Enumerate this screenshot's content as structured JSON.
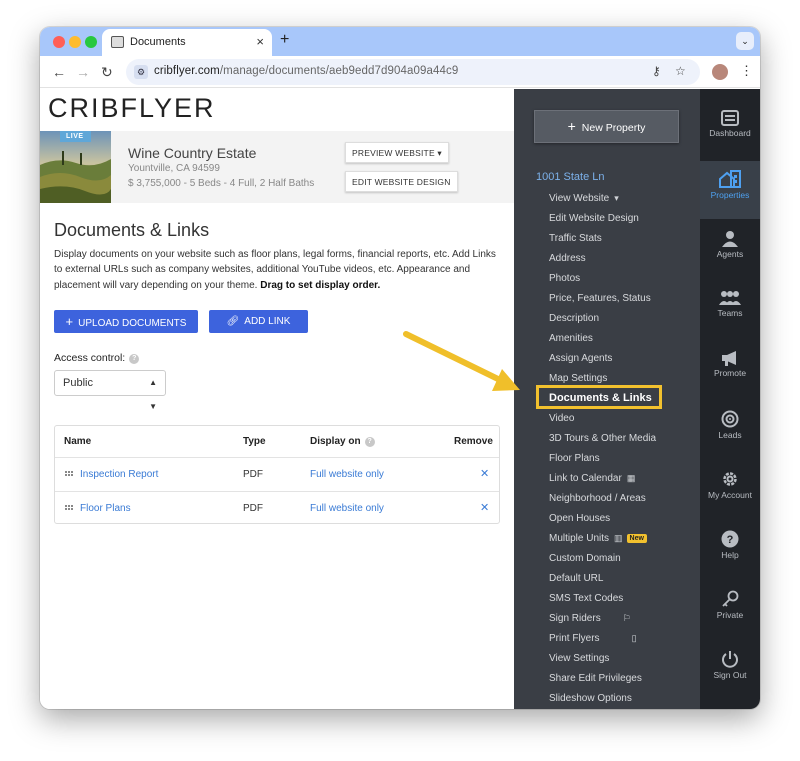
{
  "browser": {
    "tab_title": "Documents",
    "tab_close": "×",
    "new_tab": "+",
    "url_domain": "cribflyer.com",
    "url_path": "/manage/documents/aeb9edd7d904a09a44c9"
  },
  "page": {
    "logo": "CRIBFLYER",
    "property": {
      "live_badge": "LIVE",
      "name": "Wine Country Estate",
      "city": "Yountville, CA 94599",
      "summary": "$ 3,755,000 - 5 Beds - 4 Full, 2 Half Baths",
      "preview_button": "PREVIEW WEBSITE ▾",
      "edit_design_button": "EDIT WEBSITE DESIGN"
    },
    "heading": "Documents & Links",
    "description": "Display documents on your website such as floor plans, legal forms, financial reports, etc. Add Links to external URLs such as company websites, additional YouTube videos, etc. Appearance and placement will vary depending on your theme.",
    "description_bold": "Drag to set display order.",
    "upload_button": "UPLOAD DOCUMENTS",
    "add_link_button": "ADD LINK",
    "access_label": "Access control:",
    "access_value": "Public",
    "table": {
      "headers": [
        "Name",
        "Type",
        "Display on",
        "Remove"
      ],
      "rows": [
        {
          "name": "Inspection Report",
          "type": "PDF",
          "display": "Full website only"
        },
        {
          "name": "Floor Plans",
          "type": "PDF",
          "display": "Full website only"
        }
      ]
    }
  },
  "sidebar": {
    "new_property": "New Property",
    "address": "1001 State Ln",
    "items": [
      "View Website",
      "Edit Website Design",
      "Traffic Stats",
      "Address",
      "Photos",
      "Price, Features, Status",
      "Description",
      "Amenities",
      "Assign Agents",
      "Map Settings",
      "Documents & Links",
      "Video",
      "3D Tours & Other Media",
      "Floor Plans",
      "Link to Calendar",
      "Neighborhood / Areas",
      "Open Houses",
      "Multiple Units",
      "Custom Domain",
      "Default URL",
      "SMS Text Codes",
      "Sign Riders",
      "Print Flyers",
      "View Settings",
      "Share Edit Privileges",
      "Slideshow Options"
    ],
    "new_badge": "New"
  },
  "rail": {
    "items": [
      "Dashboard",
      "Properties",
      "Agents",
      "Teams",
      "Promote",
      "Leads",
      "My Account",
      "Help",
      "Private",
      "Sign Out"
    ]
  },
  "colors": {
    "accent": "#3d63dd",
    "link": "#3a7bd5",
    "sidebar_bg": "#3a3e45",
    "rail_bg": "#202328",
    "highlight": "#f2c12e"
  }
}
